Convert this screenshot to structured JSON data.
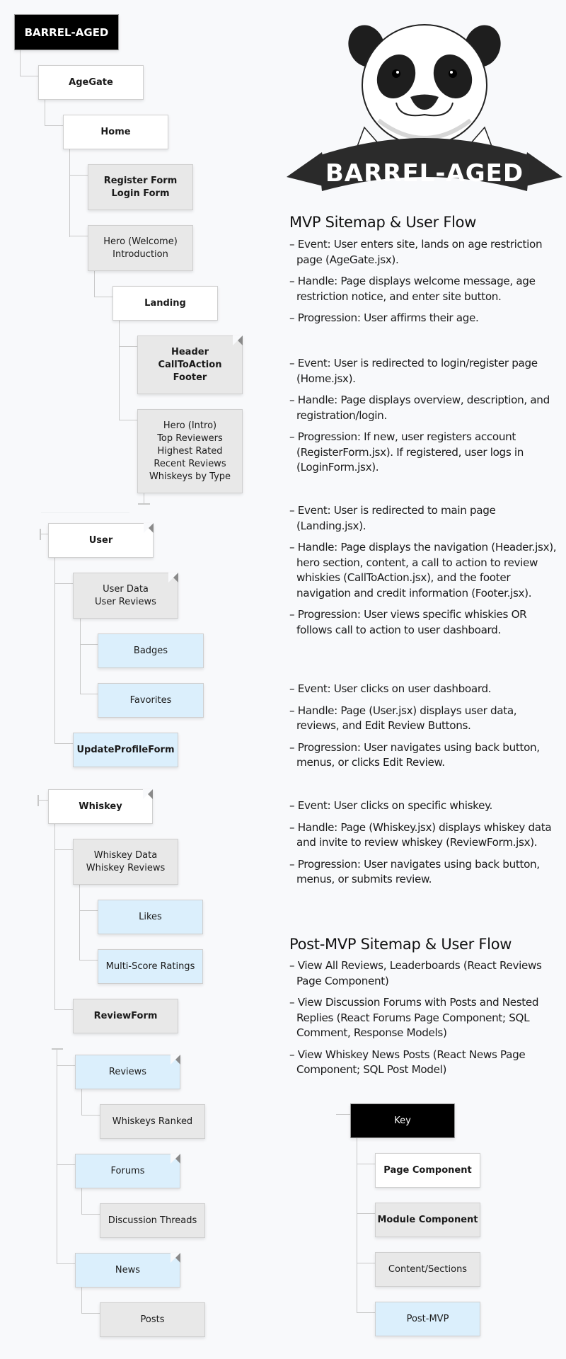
{
  "sitemap": {
    "root": "BARREL-AGED",
    "mvp": {
      "agegate": "AgeGate",
      "home": "Home",
      "home_modules": "Register Form\nLogin Form",
      "home_content": "Hero (Welcome)\nIntroduction",
      "landing": "Landing",
      "landing_modules": "Header\nCallToAction\nFooter",
      "landing_content": "Hero (Intro)\nTop Reviewers\nHighest Rated\nRecent Reviews\nWhiskeys by Type",
      "user": "User",
      "user_content": "User Data\nUser Reviews",
      "user_badges": "Badges",
      "user_favorites": "Favorites",
      "user_form": "UpdateProfileForm",
      "whiskey": "Whiskey",
      "whiskey_content": "Whiskey Data\nWhiskey Reviews",
      "whiskey_likes": "Likes",
      "whiskey_ratings": "Multi-Score Ratings",
      "whiskey_form": "ReviewForm"
    },
    "post_mvp": {
      "reviews": "Reviews",
      "reviews_child": "Whiskeys Ranked",
      "forums": "Forums",
      "forums_child": "Discussion Threads",
      "news": "News",
      "news_child": "Posts"
    }
  },
  "logo": {
    "text": "BARREL-AGED",
    "icon": "panda-mascot-icon"
  },
  "mvp_flow": {
    "heading": "MVP Sitemap & User Flow",
    "groups": [
      [
        "– Event: User enters site, lands on age restriction page (AgeGate.jsx).",
        "– Handle: Page displays welcome message, age restriction notice, and enter site button.",
        "– Progression: User affirms their age."
      ],
      [
        "– Event: User is redirected to login/register page (Home.jsx).",
        "– Handle: Page displays overview, description, and registration/login.",
        "– Progression: If new, user registers account (RegisterForm.jsx). If registered, user logs in (LoginForm.jsx)."
      ],
      [
        "– Event: User is redirected to main page (Landing.jsx).",
        "– Handle: Page displays the navigation (Header.jsx), hero section, content, a call to action to review whiskies (CallToAction.jsx), and the footer navigation and credit information (Footer.jsx).",
        "– Progression: User views specific whiskies OR follows call to action to user dashboard."
      ],
      [
        "– Event: User clicks on user dashboard.",
        "– Handle: Page (User.jsx) displays user data, reviews, and Edit Review Buttons.",
        "– Progression: User navigates using back button, menus, or clicks Edit Review."
      ],
      [
        "– Event: User clicks on specific whiskey.",
        "– Handle: Page (Whiskey.jsx) displays whiskey data and invite to review whiskey (ReviewForm.jsx).",
        "– Progression: User navigates using back button, menus, or submits review."
      ]
    ]
  },
  "post_mvp_flow": {
    "heading": "Post-MVP Sitemap & User Flow",
    "items": [
      "– View All Reviews, Leaderboards (React Reviews Page Component)",
      "– View Discussion Forums with Posts and Nested Replies (React Forums Page Component; SQL Comment, Response Models)",
      "– View Whiskey News Posts (React News Page Component; SQL Post Model)"
    ]
  },
  "key": {
    "title": "Key",
    "page_component": "Page Component",
    "module_component": "Module Component",
    "content_sections": "Content/Sections",
    "post_mvp": "Post-MVP"
  },
  "colors": {
    "background": "#f8f9fb",
    "page_component": "#ffffff",
    "module_component": "#e8e8e8",
    "content_sections": "#e8e8e8",
    "post_mvp": "#dbeffc",
    "root": "#000000"
  }
}
